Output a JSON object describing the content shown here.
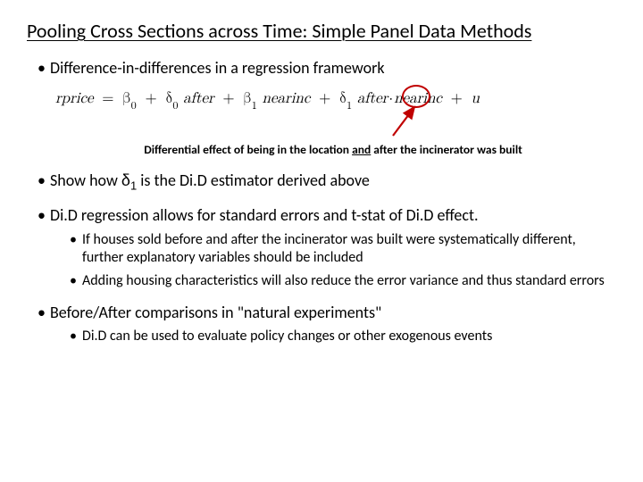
{
  "title": "Pooling Cross Sections across Time: Simple Panel Data Methods",
  "b1": "Difference-in-differences in a regression framework",
  "eq": {
    "lhs": "rprice",
    "eqs": "=",
    "t_b0a": "β",
    "t_b0s": "0",
    "plus": "+",
    "t_d0a": "δ",
    "t_d0s": "0",
    "after": "after",
    "t_b1a": "β",
    "t_b1s": "1",
    "nearinc": "nearinc",
    "t_d1a": "δ",
    "t_d1s": "1",
    "dot": "·",
    "u": "u"
  },
  "caption_pre": "Differential effect of being in the location ",
  "caption_and": "and",
  "caption_post": " after the incinerator was built",
  "b2_pre": "Show how ",
  "b2_delta": "δ",
  "b2_sub": "1",
  "b2_post": " is the Di.D estimator derived above",
  "b3": "Di.D regression allows for standard errors and t-stat of Di.D effect.",
  "b3s1": "If houses sold before and after the incinerator was built were systematically different, further explanatory variables should be included",
  "b3s2": "Adding housing characteristics will also reduce the error variance and thus standard errors",
  "b4": "Before/After comparisons in \"natural experiments\"",
  "b4s1": "Di.D can be used to evaluate policy changes or other exogenous events"
}
